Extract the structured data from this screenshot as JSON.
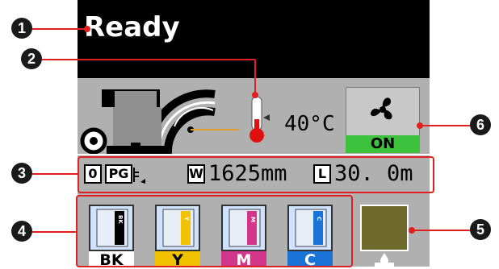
{
  "status": {
    "text": "Ready"
  },
  "temperature": {
    "value": "40°C"
  },
  "fan": {
    "icon": "fan-icon",
    "state": "ON"
  },
  "media": {
    "slot": "0",
    "type": "PG",
    "width_label": "W",
    "width_value": "1625mm",
    "length_label": "L",
    "length_value": "30. 0m"
  },
  "inks": [
    {
      "label": "BK",
      "tag": "BK",
      "color": "#000000",
      "label_bg": "#ffffff"
    },
    {
      "label": "Y",
      "tag": "Y",
      "color": "#f2c200",
      "label_bg": "#f2c200"
    },
    {
      "label": "M",
      "tag": "M",
      "color": "#d2368a",
      "label_bg": "#d2368a"
    },
    {
      "label": "C",
      "tag": "C",
      "color": "#1a74d8",
      "label_bg": "#1a74d8"
    }
  ],
  "waste": {
    "color": "#6e6a2c"
  },
  "callouts": [
    "1",
    "2",
    "3",
    "4",
    "5",
    "6"
  ]
}
